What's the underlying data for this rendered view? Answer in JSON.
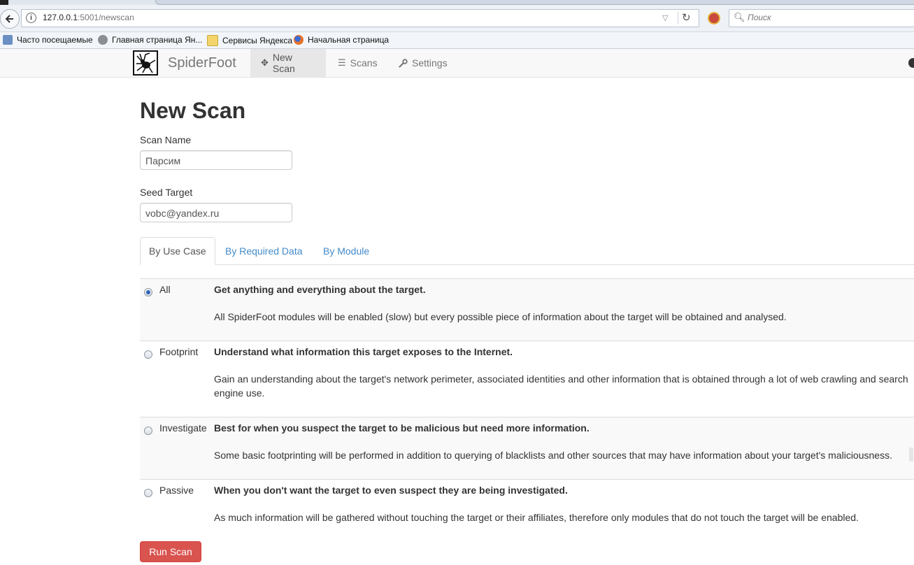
{
  "browser": {
    "url_host": "127.0.0.1",
    "url_rest": ":5001/newscan",
    "search_placeholder": "Поиск",
    "bookmarks": [
      {
        "label": "Часто посещаемые",
        "icon": "bookmark-folder-icon"
      },
      {
        "label": "Главная страница Ян...",
        "icon": "globe-icon"
      },
      {
        "label": "Сервисы Яндекса",
        "icon": "folder-icon"
      },
      {
        "label": "Начальная страница",
        "icon": "firefox-icon"
      }
    ]
  },
  "appnav": {
    "brand": "SpiderFoot",
    "items": [
      {
        "label": "New Scan",
        "icon": "move-icon",
        "active": true
      },
      {
        "label": "Scans",
        "icon": "list-icon",
        "active": false
      },
      {
        "label": "Settings",
        "icon": "wrench-icon",
        "active": false
      }
    ]
  },
  "page": {
    "title": "New Scan",
    "scan_name_label": "Scan Name",
    "scan_name_value": "Парсим",
    "seed_target_label": "Seed Target",
    "seed_target_value": "vobc@yandex.ru",
    "tabs": [
      "By Use Case",
      "By Required Data",
      "By Module"
    ],
    "active_tab": "By Use Case",
    "use_cases": [
      {
        "name": "All",
        "title": "Get anything and everything about the target.",
        "description": "All SpiderFoot modules will be enabled (slow) but every possible piece of information about the target will be obtained and analysed.",
        "selected": true
      },
      {
        "name": "Footprint",
        "title": "Understand what information this target exposes to the Internet.",
        "description": "Gain an understanding about the target's network perimeter, associated identities and other information that is obtained through a lot of web crawling and search engine use.",
        "selected": false
      },
      {
        "name": "Investigate",
        "title": "Best for when you suspect the target to be malicious but need more information.",
        "description": "Some basic footprinting will be performed in addition to querying of blacklists and other sources that may have information about your target's maliciousness.",
        "selected": false
      },
      {
        "name": "Passive",
        "title": "When you don't want the target to even suspect they are being investigated.",
        "description": "As much information will be gathered without touching the target or their affiliates, therefore only modules that do not touch the target will be enabled.",
        "selected": false
      }
    ],
    "run_button": "Run Scan"
  },
  "colors": {
    "run_button": "#d9534f",
    "link": "#428bca",
    "navbar": "#f8f8f8"
  }
}
